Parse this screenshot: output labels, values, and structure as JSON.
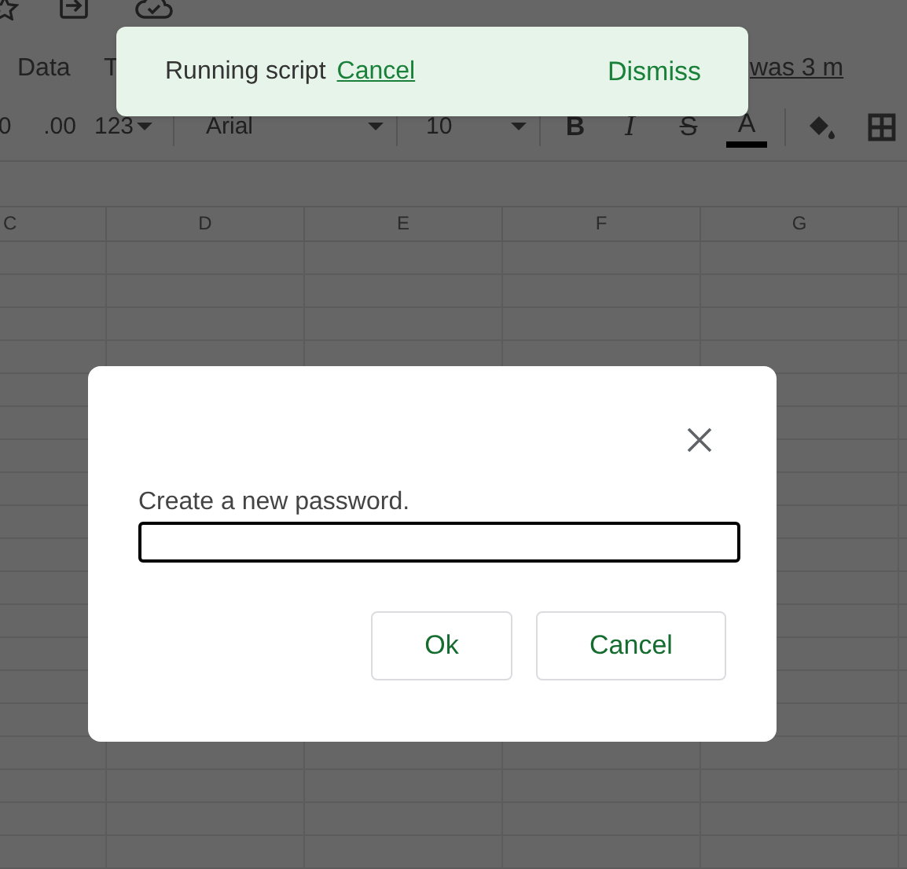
{
  "menu": [
    {
      "label": "Data"
    },
    {
      "label": "T"
    }
  ],
  "last_edit": "was 3 m",
  "toolbar": {
    "decrease_decimal": "0",
    "increase_decimal": ".00",
    "number_format": "123",
    "font": "Arial",
    "font_size": "10",
    "bold": "B",
    "italic": "I",
    "strikethrough": "S",
    "text_color": "A"
  },
  "columns": [
    "C",
    "D",
    "E",
    "F",
    "G"
  ],
  "toast": {
    "message": "Running script",
    "link": "Cancel",
    "action": "Dismiss"
  },
  "dialog": {
    "prompt": "Create a new password.",
    "buttons": [
      "Ok",
      "Cancel"
    ]
  }
}
